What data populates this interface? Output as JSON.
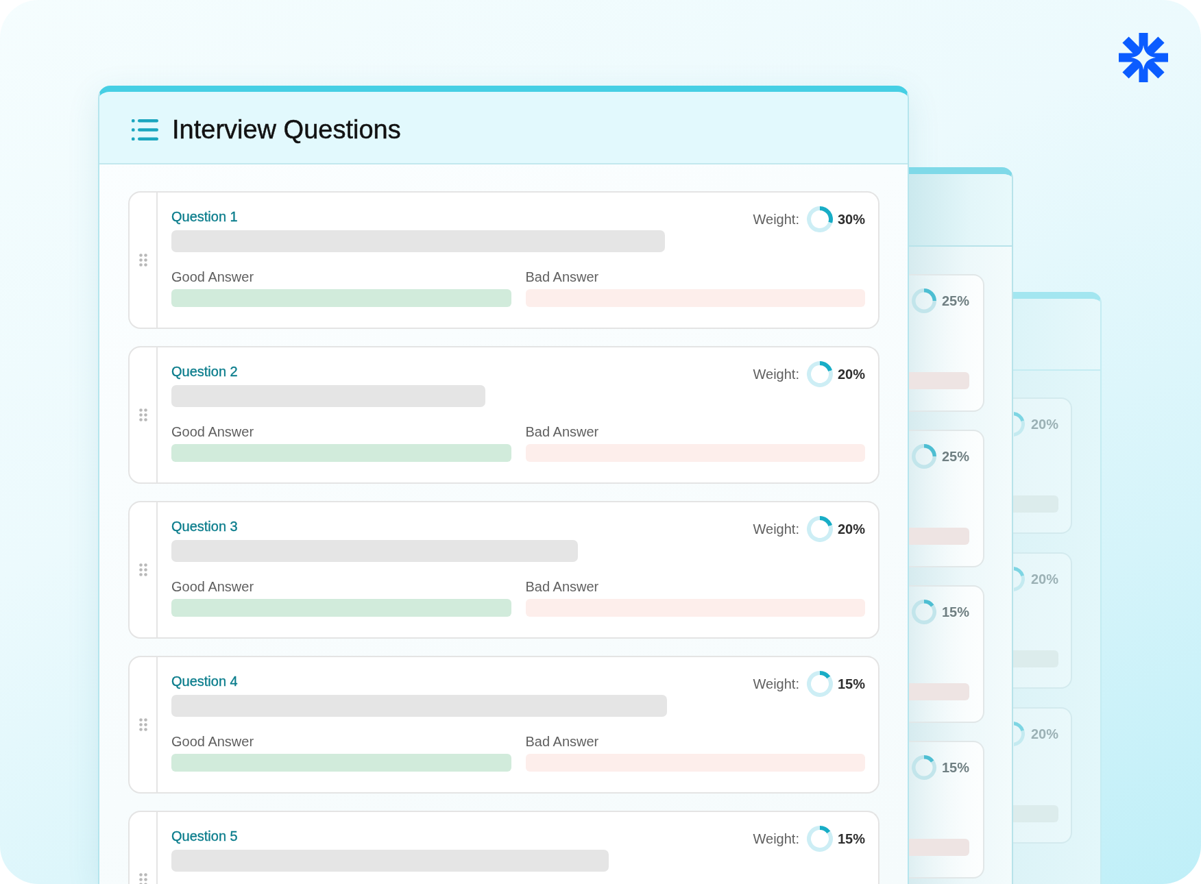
{
  "front_panel": {
    "title": "Interview Questions",
    "questions": [
      {
        "label": "Question 1",
        "weight_label": "Weight:",
        "weight": "30%",
        "chart_data": {
          "type": "donut",
          "values": [
            30,
            70
          ]
        },
        "answers": [
          {
            "kind": "good",
            "label": "Good Answer"
          },
          {
            "kind": "bad",
            "label": "Bad Answer"
          }
        ]
      },
      {
        "label": "Question 2",
        "weight_label": "Weight:",
        "weight": "20%",
        "chart_data": {
          "type": "donut",
          "values": [
            20,
            80
          ]
        },
        "answers": [
          {
            "kind": "good",
            "label": "Good Answer"
          },
          {
            "kind": "bad",
            "label": "Bad Answer"
          }
        ]
      },
      {
        "label": "Question 3",
        "weight_label": "Weight:",
        "weight": "20%",
        "chart_data": {
          "type": "donut",
          "values": [
            20,
            80
          ]
        },
        "answers": [
          {
            "kind": "good",
            "label": "Good Answer"
          },
          {
            "kind": "bad",
            "label": "Bad Answer"
          }
        ]
      },
      {
        "label": "Question 4",
        "weight_label": "Weight:",
        "weight": "15%",
        "chart_data": {
          "type": "donut",
          "values": [
            15,
            85
          ]
        },
        "answers": [
          {
            "kind": "good",
            "label": "Good Answer"
          },
          {
            "kind": "bad",
            "label": "Bad Answer"
          }
        ]
      },
      {
        "label": "Question 5",
        "weight_label": "Weight:",
        "weight": "15%",
        "chart_data": {
          "type": "donut",
          "values": [
            15,
            85
          ]
        }
      }
    ]
  },
  "back_panels": [
    {
      "cards": [
        {
          "weight": "25%",
          "chart_data": {
            "type": "donut",
            "values": [
              25,
              75
            ]
          }
        },
        {
          "weight": "25%",
          "chart_data": {
            "type": "donut",
            "values": [
              25,
              75
            ]
          }
        },
        {
          "weight": "15%",
          "chart_data": {
            "type": "donut",
            "values": [
              15,
              85
            ]
          }
        },
        {
          "weight": "15%",
          "chart_data": {
            "type": "donut",
            "values": [
              15,
              85
            ]
          }
        }
      ]
    },
    {
      "cards": [
        {
          "weight": "20%"
        },
        {
          "weight": "20%"
        },
        {
          "weight": "20%"
        }
      ]
    }
  ]
}
